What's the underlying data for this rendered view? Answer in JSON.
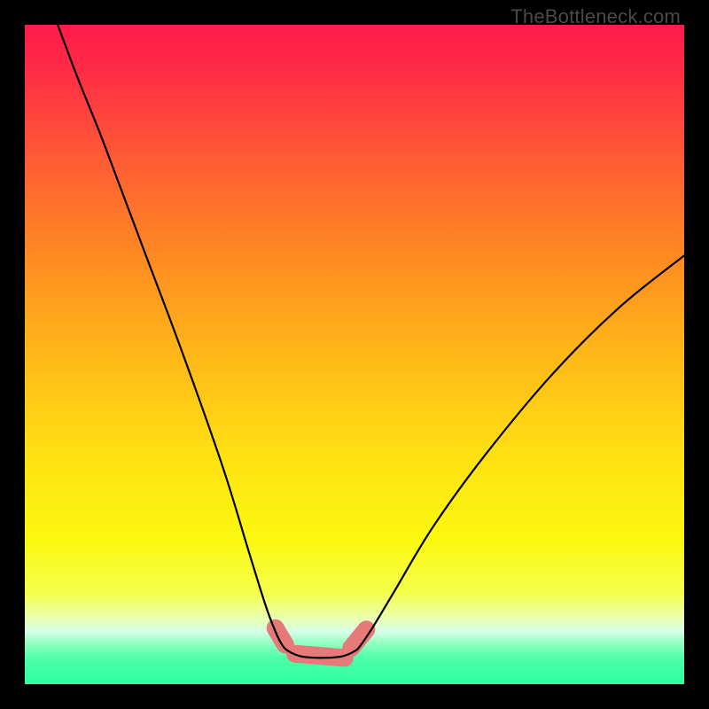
{
  "watermark": "TheBottleneck.com",
  "chart_data": {
    "type": "line",
    "title": "",
    "xlabel": "",
    "ylabel": "",
    "xlim": [
      0,
      100
    ],
    "ylim": [
      0,
      100
    ],
    "grid": false,
    "legend": false,
    "background_gradient_stops": [
      {
        "offset": 0.0,
        "color": "#ff1a4b"
      },
      {
        "offset": 0.07,
        "color": "#ff2c46"
      },
      {
        "offset": 0.2,
        "color": "#ff5a35"
      },
      {
        "offset": 0.35,
        "color": "#ff8a22"
      },
      {
        "offset": 0.5,
        "color": "#ffb718"
      },
      {
        "offset": 0.65,
        "color": "#ffe013"
      },
      {
        "offset": 0.78,
        "color": "#fbf80f"
      },
      {
        "offset": 0.86,
        "color": "#f5ff4a"
      },
      {
        "offset": 0.9,
        "color": "#eaffb0"
      },
      {
        "offset": 0.92,
        "color": "#d7ffea"
      },
      {
        "offset": 0.935,
        "color": "#9cffc4"
      },
      {
        "offset": 0.96,
        "color": "#4dffa8"
      },
      {
        "offset": 1.0,
        "color": "#2bff9e"
      }
    ],
    "series": [
      {
        "name": "bottleneck-curve",
        "stroke": "#000000",
        "stroke_width": 2.2,
        "points": [
          {
            "x": 5.0,
            "y": 100.0
          },
          {
            "x": 8.0,
            "y": 92.0
          },
          {
            "x": 12.0,
            "y": 82.0
          },
          {
            "x": 18.0,
            "y": 66.0
          },
          {
            "x": 24.0,
            "y": 50.0
          },
          {
            "x": 30.0,
            "y": 33.0
          },
          {
            "x": 34.0,
            "y": 20.0
          },
          {
            "x": 36.5,
            "y": 12.0
          },
          {
            "x": 38.0,
            "y": 8.0
          },
          {
            "x": 39.0,
            "y": 6.0
          },
          {
            "x": 40.0,
            "y": 5.0
          },
          {
            "x": 42.0,
            "y": 4.2
          },
          {
            "x": 45.0,
            "y": 4.0
          },
          {
            "x": 48.0,
            "y": 4.2
          },
          {
            "x": 50.0,
            "y": 5.0
          },
          {
            "x": 51.0,
            "y": 6.0
          },
          {
            "x": 53.0,
            "y": 9.0
          },
          {
            "x": 56.0,
            "y": 14.0
          },
          {
            "x": 62.0,
            "y": 24.0
          },
          {
            "x": 70.0,
            "y": 35.0
          },
          {
            "x": 80.0,
            "y": 47.0
          },
          {
            "x": 90.0,
            "y": 57.0
          },
          {
            "x": 100.0,
            "y": 65.0
          }
        ]
      },
      {
        "name": "highlight-left-blob",
        "type": "blob",
        "fill": "#e57a78",
        "points": [
          {
            "x": 38.0,
            "y": 8.5
          },
          {
            "x": 39.5,
            "y": 6.0
          }
        ]
      },
      {
        "name": "highlight-bottom-blob",
        "type": "blob",
        "fill": "#e57a78",
        "points": [
          {
            "x": 41.0,
            "y": 4.6
          },
          {
            "x": 48.5,
            "y": 4.0
          }
        ]
      },
      {
        "name": "highlight-right-blob",
        "type": "blob",
        "fill": "#e57a78",
        "points": [
          {
            "x": 49.5,
            "y": 5.5
          },
          {
            "x": 51.8,
            "y": 8.3
          }
        ]
      }
    ]
  }
}
